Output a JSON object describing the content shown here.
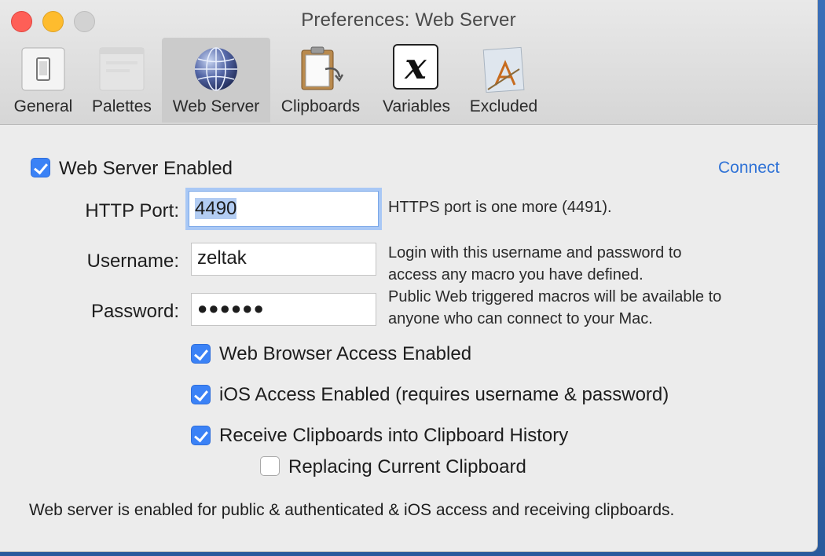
{
  "window": {
    "title": "Preferences: Web Server"
  },
  "toolbar": {
    "items": [
      {
        "label": "General",
        "icon": "switch-icon"
      },
      {
        "label": "Palettes",
        "icon": "palette-icon"
      },
      {
        "label": "Web Server",
        "icon": "globe-icon",
        "selected": true
      },
      {
        "label": "Clipboards",
        "icon": "clipboard-icon"
      },
      {
        "label": "Variables",
        "icon": "variable-x-icon",
        "glyph": "x"
      },
      {
        "label": "Excluded",
        "icon": "excluded-app-icon"
      }
    ]
  },
  "web_server": {
    "enabled_label": "Web Server Enabled",
    "enabled": true,
    "connect_link": "Connect"
  },
  "http_port": {
    "label": "HTTP Port:",
    "value": "4490",
    "help": "HTTPS port is one more (4491)."
  },
  "username": {
    "label": "Username:",
    "value": "zeltak",
    "help_line1": "Login with this username and password to",
    "help_line2": "access any macro you have defined."
  },
  "password": {
    "label": "Password:",
    "value": "●●●●●●",
    "help_line1": "Public Web triggered macros will be available to",
    "help_line2": "anyone who can connect to your Mac."
  },
  "options": {
    "browser_access": {
      "label": "Web Browser Access Enabled",
      "checked": true
    },
    "ios_access": {
      "label": "iOS Access Enabled (requires username & password)",
      "checked": true
    },
    "receive_clipboards": {
      "label": "Receive Clipboards into Clipboard History",
      "checked": true
    },
    "replace_clipboard": {
      "label": "Replacing Current Clipboard",
      "checked": false
    }
  },
  "status": "Web server is enabled for public & authenticated & iOS access and receiving clipboards.",
  "colors": {
    "accent": "#3b82f6",
    "link": "#2f72d6",
    "window_bg": "#ececec"
  }
}
